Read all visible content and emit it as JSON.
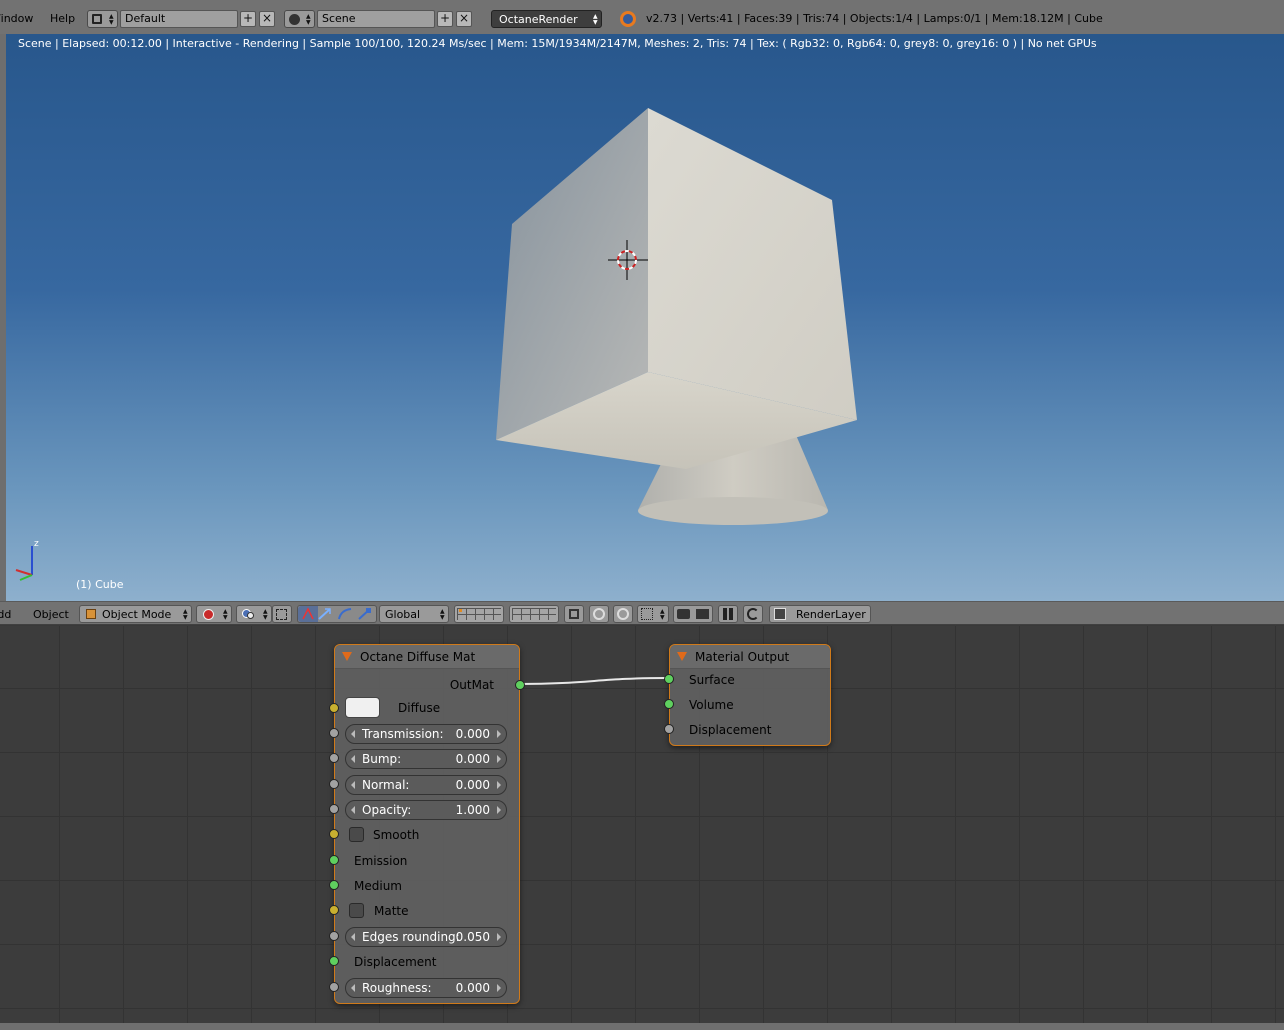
{
  "topbar": {
    "menu_window": "Window",
    "menu_help": "Help",
    "screen_layout": "Default",
    "scene": "Scene",
    "render_engine": "OctaneRender",
    "stats": "v2.73 | Verts:41 | Faces:39 | Tris:74 | Objects:1/4 | Lamps:0/1 | Mem:18.12M | Cube"
  },
  "viewport": {
    "status": "Scene | Elapsed: 00:12.00 | Interactive - Rendering | Sample 100/100, 120.24 Ms/sec | Mem: 15M/1934M/2147M, Meshes: 2, Tris: 74 | Tex: ( Rgb32: 0, Rgb64: 0, grey8: 0, grey16: 0 ) | No net GPUs",
    "object_label": "(1) Cube",
    "axis_z": "z"
  },
  "view_header": {
    "menu_add": "Add",
    "menu_object": "Object",
    "mode": "Object Mode",
    "orientation": "Global",
    "render_layer": "RenderLayer"
  },
  "diffuse_node": {
    "title": "Octane Diffuse Mat",
    "output": "OutMat",
    "diffuse": "Diffuse",
    "transmission": {
      "label": "Transmission:",
      "value": "0.000"
    },
    "bump": {
      "label": "Bump:",
      "value": "0.000"
    },
    "normal": {
      "label": "Normal:",
      "value": "0.000"
    },
    "opacity": {
      "label": "Opacity:",
      "value": "1.000"
    },
    "smooth": "Smooth",
    "emission": "Emission",
    "medium": "Medium",
    "matte": "Matte",
    "edges_rounding": {
      "label": "Edges rounding:",
      "value": "0.050"
    },
    "displacement": "Displacement",
    "roughness": {
      "label": "Roughness:",
      "value": "0.000"
    }
  },
  "output_node": {
    "title": "Material Output",
    "surface": "Surface",
    "volume": "Volume",
    "displacement": "Displacement"
  },
  "colors": {
    "socket_shader": "#5fd05f",
    "socket_color": "#c9b030",
    "socket_value": "#a2a2a2",
    "node_border": "#d07a1a"
  }
}
